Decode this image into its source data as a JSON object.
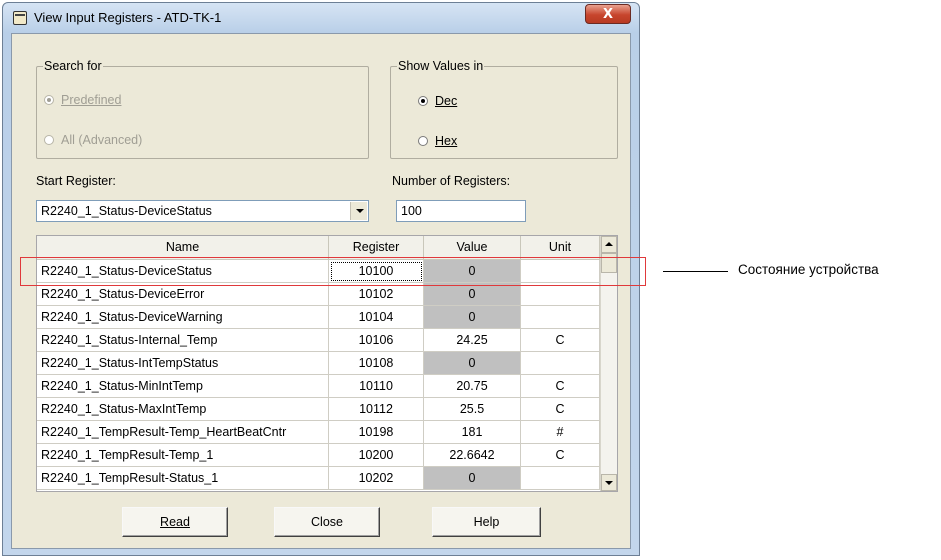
{
  "window": {
    "title": "View Input Registers - ATD-TK-1",
    "close_glyph": "X"
  },
  "search_for": {
    "legend": "Search for",
    "options": [
      {
        "label": "Predefined",
        "selected": true,
        "enabled": false
      },
      {
        "label": "All (Advanced)",
        "selected": false,
        "enabled": false
      }
    ]
  },
  "show_values_in": {
    "legend": "Show Values in",
    "options": [
      {
        "label": "Dec",
        "selected": true
      },
      {
        "label": "Hex",
        "selected": false
      }
    ]
  },
  "start_register": {
    "label": "Start Register:",
    "value": "R2240_1_Status-DeviceStatus"
  },
  "number_of_registers": {
    "label": "Number of Registers:",
    "value": "100"
  },
  "table": {
    "columns": [
      "Name",
      "Register",
      "Value",
      "Unit"
    ],
    "rows": [
      {
        "name": "R2240_1_Status-DeviceStatus",
        "register": "10100",
        "value": "0",
        "unit": "",
        "value_gray": true
      },
      {
        "name": "R2240_1_Status-DeviceError",
        "register": "10102",
        "value": "0",
        "unit": "",
        "value_gray": true
      },
      {
        "name": "R2240_1_Status-DeviceWarning",
        "register": "10104",
        "value": "0",
        "unit": "",
        "value_gray": true
      },
      {
        "name": "R2240_1_Status-Internal_Temp",
        "register": "10106",
        "value": "24.25",
        "unit": "C",
        "value_gray": false
      },
      {
        "name": "R2240_1_Status-IntTempStatus",
        "register": "10108",
        "value": "0",
        "unit": "",
        "value_gray": true
      },
      {
        "name": "R2240_1_Status-MinIntTemp",
        "register": "10110",
        "value": "20.75",
        "unit": "C",
        "value_gray": false
      },
      {
        "name": "R2240_1_Status-MaxIntTemp",
        "register": "10112",
        "value": "25.5",
        "unit": "C",
        "value_gray": false
      },
      {
        "name": "R2240_1_TempResult-Temp_HeartBeatCntr",
        "register": "10198",
        "value": "181",
        "unit": "#",
        "value_gray": false
      },
      {
        "name": "R2240_1_TempResult-Temp_1",
        "register": "10200",
        "value": "22.6642",
        "unit": "C",
        "value_gray": false
      },
      {
        "name": "R2240_1_TempResult-Status_1",
        "register": "10202",
        "value": "0",
        "unit": "",
        "value_gray": true
      }
    ]
  },
  "buttons": {
    "read": "Read",
    "close": "Close",
    "help": "Help"
  },
  "annotation": {
    "text": "Состояние устройства",
    "color": "#e0393b"
  }
}
